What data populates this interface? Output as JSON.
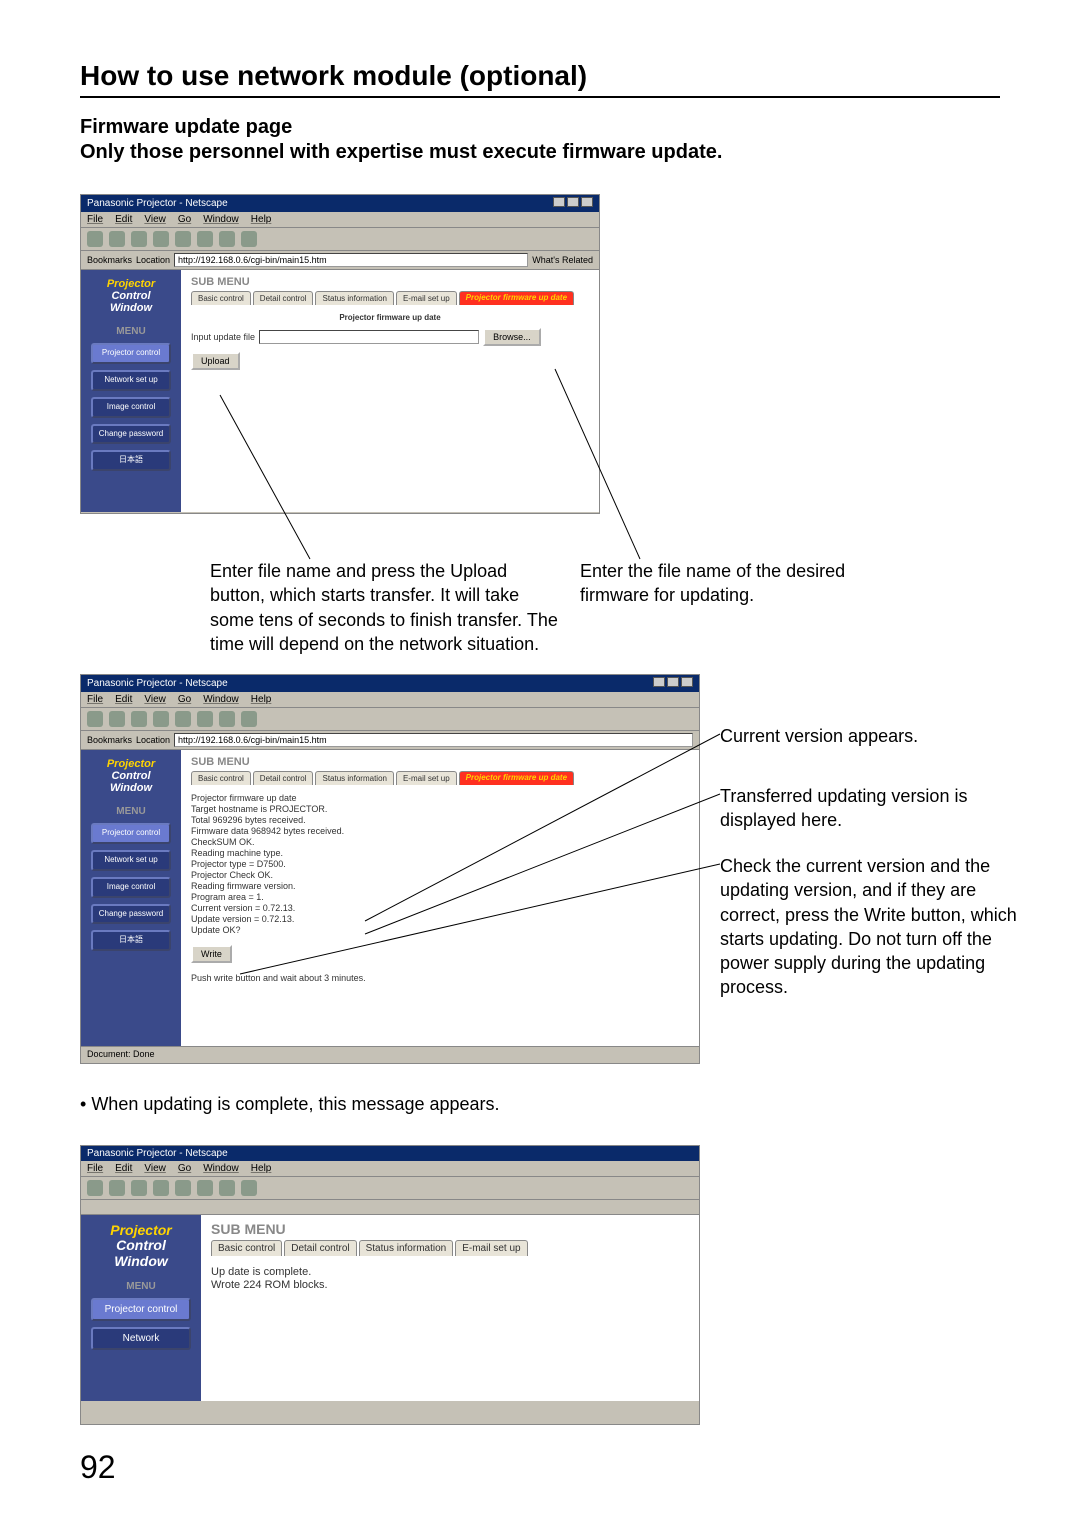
{
  "page": {
    "title": "How to use network module (optional)",
    "subtitle": "Firmware update page",
    "subnote": "Only those personnel with expertise must execute firmware update.",
    "page_number": "92"
  },
  "browser": {
    "title": "Panasonic Projector - Netscape",
    "menu": [
      "File",
      "Edit",
      "View",
      "Go",
      "Window",
      "Help"
    ],
    "bookmarks_label": "Bookmarks",
    "location_label": "Location",
    "url": "http://192.168.0.6/cgi-bin/main15.htm",
    "whats_related": "What's Related",
    "status_done": "Document: Done"
  },
  "sidebar": {
    "brand_l1": "Projector",
    "brand_l2": "Control",
    "brand_l3": "Window",
    "menu_label": "MENU",
    "items": [
      "Projector\ncontrol",
      "Network\nset up",
      "Image\ncontrol",
      "Change\npassword",
      "日本語"
    ]
  },
  "submenu": {
    "label": "SUB MENU",
    "tabs": [
      "Basic control",
      "Detail control",
      "Status information",
      "E-mail set up"
    ],
    "active_tab": "Projector\nfirmware up date"
  },
  "screenshot1": {
    "center_label": "Projector firmware up date",
    "input_label": "Input update file",
    "browse_btn": "Browse...",
    "upload_btn": "Upload"
  },
  "screenshot2": {
    "lines": [
      "Projector firmware up date",
      "",
      "Target hostname is PROJECTOR.",
      "Total 969296 bytes received.",
      "Firmware data 968942 bytes received.",
      "CheckSUM OK.",
      "Reading machine type.",
      "Projector type = D7500.",
      "Projector Check OK.",
      "",
      "Reading firmware version.",
      "Program area = 1.",
      "Current version = 0.72.13.",
      "Update version = 0.72.13.",
      "",
      "Update OK?"
    ],
    "write_btn": "Write",
    "push_line": "Push write button and wait about 3 minutes."
  },
  "screenshot3": {
    "complete_line": "Up date is complete.",
    "blocks_line": "Wrote 224 ROM blocks."
  },
  "callouts": {
    "c1": "Enter file name and press the Upload button, which starts transfer.  It will take some tens of seconds to finish transfer. The time will depend on the network situation.",
    "c2": "Enter the file name of the desired firmware for updating.",
    "c3": "Current version appears.",
    "c4": "Transferred updating version is displayed here.",
    "c5": "Check the current version and the updating version, and if they are correct, press the Write button, which starts updating.  Do not turn off the power supply during the updating process.",
    "bullet": "When updating is complete, this message appears."
  }
}
